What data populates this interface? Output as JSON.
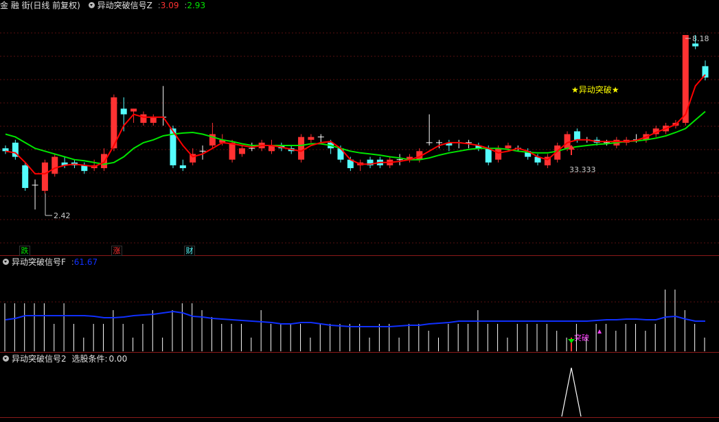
{
  "main_panel": {
    "stock_name": "金 融 街",
    "period_info": "(日线 前复权)",
    "indicator_name": "异动突破信号Z",
    "value_red": "3.09",
    "value_green": "2.93",
    "high_label": "8.18",
    "low_label": "2.42",
    "signal_text": "★异动突破★",
    "signal_value": "33.333",
    "badges": [
      "跌",
      "涨",
      "财"
    ],
    "colors": {
      "up": "#ff3232",
      "down": "#54fcfc",
      "ma_fast": "#ff0000",
      "ma_slow": "#00e600",
      "signal": "#ffff00"
    }
  },
  "panel_f": {
    "indicator_name": "异动突破信号F",
    "value": "61.67",
    "marker_text": "突破",
    "colors": {
      "line": "#1030ff",
      "bars": "#ffffff",
      "marker": "#ff40ff"
    }
  },
  "panel_2": {
    "indicator_name": "异动突破信号2",
    "condition_label": "选股条件:",
    "condition_value": "0.00"
  },
  "chart_data": {
    "type": "candlestick",
    "candles": [
      {
        "o": 3.5,
        "c": 3.45,
        "h": 3.55,
        "l": 3.4
      },
      {
        "o": 3.6,
        "c": 3.35,
        "h": 3.65,
        "l": 3.3
      },
      {
        "o": 3.2,
        "c": 2.8,
        "h": 3.25,
        "l": 2.75
      },
      {
        "o": 2.85,
        "c": 2.85,
        "h": 2.95,
        "l": 2.42
      },
      {
        "o": 2.75,
        "c": 3.25,
        "h": 3.3,
        "l": 2.7
      },
      {
        "o": 3.05,
        "c": 3.35,
        "h": 3.4,
        "l": 3.0
      },
      {
        "o": 3.25,
        "c": 3.2,
        "h": 3.35,
        "l": 3.15
      },
      {
        "o": 3.25,
        "c": 3.2,
        "h": 3.3,
        "l": 3.15
      },
      {
        "o": 3.2,
        "c": 3.1,
        "h": 3.25,
        "l": 3.05
      },
      {
        "o": 3.15,
        "c": 3.2,
        "h": 3.3,
        "l": 3.1
      },
      {
        "o": 3.15,
        "c": 3.4,
        "h": 3.5,
        "l": 3.1
      },
      {
        "o": 3.5,
        "c": 4.4,
        "h": 4.45,
        "l": 3.45
      },
      {
        "o": 4.2,
        "c": 4.1,
        "h": 4.4,
        "l": 3.8
      },
      {
        "o": 4.15,
        "c": 4.2,
        "h": 4.2,
        "l": 3.95
      },
      {
        "o": 3.95,
        "c": 4.1,
        "h": 4.15,
        "l": 3.9
      },
      {
        "o": 3.95,
        "c": 4.05,
        "h": 4.1,
        "l": 3.9
      },
      {
        "o": 4.05,
        "c": 4.05,
        "h": 4.6,
        "l": 3.9
      },
      {
        "o": 3.85,
        "c": 3.2,
        "h": 3.9,
        "l": 3.15
      },
      {
        "o": 3.2,
        "c": 3.15,
        "h": 3.3,
        "l": 3.1
      },
      {
        "o": 3.25,
        "c": 3.4,
        "h": 3.5,
        "l": 3.2
      },
      {
        "o": 3.45,
        "c": 3.45,
        "h": 3.55,
        "l": 3.3
      },
      {
        "o": 3.55,
        "c": 3.75,
        "h": 3.95,
        "l": 3.5
      },
      {
        "o": 3.6,
        "c": 3.65,
        "h": 3.75,
        "l": 3.55
      },
      {
        "o": 3.3,
        "c": 3.6,
        "h": 3.65,
        "l": 3.25
      },
      {
        "o": 3.4,
        "c": 3.5,
        "h": 3.55,
        "l": 3.35
      },
      {
        "o": 3.5,
        "c": 3.5,
        "h": 3.6,
        "l": 3.45
      },
      {
        "o": 3.5,
        "c": 3.6,
        "h": 3.65,
        "l": 3.45
      },
      {
        "o": 3.45,
        "c": 3.55,
        "h": 3.65,
        "l": 3.4
      },
      {
        "o": 3.55,
        "c": 3.5,
        "h": 3.6,
        "l": 3.45
      },
      {
        "o": 3.5,
        "c": 3.45,
        "h": 3.55,
        "l": 3.4
      },
      {
        "o": 3.3,
        "c": 3.7,
        "h": 3.75,
        "l": 3.25
      },
      {
        "o": 3.65,
        "c": 3.7,
        "h": 3.75,
        "l": 3.6
      },
      {
        "o": 3.7,
        "c": 3.7,
        "h": 3.75,
        "l": 3.6
      },
      {
        "o": 3.6,
        "c": 3.5,
        "h": 3.65,
        "l": 3.4
      },
      {
        "o": 3.5,
        "c": 3.3,
        "h": 3.55,
        "l": 3.25
      },
      {
        "o": 3.3,
        "c": 3.15,
        "h": 3.35,
        "l": 3.1
      },
      {
        "o": 3.2,
        "c": 3.25,
        "h": 3.3,
        "l": 3.1
      },
      {
        "o": 3.3,
        "c": 3.2,
        "h": 3.35,
        "l": 3.15
      },
      {
        "o": 3.3,
        "c": 3.2,
        "h": 3.35,
        "l": 3.15
      },
      {
        "o": 3.2,
        "c": 3.3,
        "h": 3.35,
        "l": 3.15
      },
      {
        "o": 3.3,
        "c": 3.3,
        "h": 3.4,
        "l": 3.2
      },
      {
        "o": 3.3,
        "c": 3.35,
        "h": 3.4,
        "l": 3.25
      },
      {
        "o": 3.3,
        "c": 3.45,
        "h": 3.5,
        "l": 3.25
      },
      {
        "o": 3.6,
        "c": 3.6,
        "h": 4.1,
        "l": 3.55
      },
      {
        "o": 3.6,
        "c": 3.6,
        "h": 3.65,
        "l": 3.5
      },
      {
        "o": 3.6,
        "c": 3.55,
        "h": 3.65,
        "l": 3.45
      },
      {
        "o": 3.6,
        "c": 3.6,
        "h": 3.65,
        "l": 3.5
      },
      {
        "o": 3.6,
        "c": 3.6,
        "h": 3.65,
        "l": 3.5
      },
      {
        "o": 3.55,
        "c": 3.5,
        "h": 3.6,
        "l": 3.45
      },
      {
        "o": 3.5,
        "c": 3.25,
        "h": 3.55,
        "l": 3.2
      },
      {
        "o": 3.3,
        "c": 3.5,
        "h": 3.55,
        "l": 3.25
      },
      {
        "o": 3.5,
        "c": 3.55,
        "h": 3.6,
        "l": 3.45
      },
      {
        "o": 3.5,
        "c": 3.5,
        "h": 3.55,
        "l": 3.45
      },
      {
        "o": 3.45,
        "c": 3.35,
        "h": 3.5,
        "l": 3.3
      },
      {
        "o": 3.35,
        "c": 3.25,
        "h": 3.4,
        "l": 3.2
      },
      {
        "o": 3.2,
        "c": 3.35,
        "h": 3.4,
        "l": 3.15
      },
      {
        "o": 3.3,
        "c": 3.55,
        "h": 3.6,
        "l": 3.25
      },
      {
        "o": 3.5,
        "c": 3.75,
        "h": 3.8,
        "l": 3.45
      },
      {
        "o": 3.8,
        "c": 3.65,
        "h": 3.85,
        "l": 3.6
      },
      {
        "o": 3.65,
        "c": 3.65,
        "h": 3.7,
        "l": 3.6
      },
      {
        "o": 3.65,
        "c": 3.6,
        "h": 3.7,
        "l": 3.55
      },
      {
        "o": 3.6,
        "c": 3.6,
        "h": 3.65,
        "l": 3.55
      },
      {
        "o": 3.55,
        "c": 3.65,
        "h": 3.7,
        "l": 3.5
      },
      {
        "o": 3.6,
        "c": 3.65,
        "h": 3.7,
        "l": 3.55
      },
      {
        "o": 3.65,
        "c": 3.65,
        "h": 3.75,
        "l": 3.6
      },
      {
        "o": 3.65,
        "c": 3.75,
        "h": 3.8,
        "l": 3.6
      },
      {
        "o": 3.75,
        "c": 3.85,
        "h": 3.9,
        "l": 3.7
      },
      {
        "o": 3.8,
        "c": 3.9,
        "h": 3.95,
        "l": 3.75
      },
      {
        "o": 3.9,
        "c": 3.95,
        "h": 4.0,
        "l": 3.85
      },
      {
        "o": 3.95,
        "c": 5.5,
        "h": 5.5,
        "l": 3.9
      },
      {
        "o": 5.35,
        "c": 5.3,
        "h": 5.5,
        "l": 5.25
      },
      {
        "o": 4.95,
        "c": 4.75,
        "h": 5.05,
        "l": 4.7
      }
    ],
    "ma_fast": [
      3.45,
      3.42,
      3.25,
      3.05,
      3.05,
      3.15,
      3.2,
      3.22,
      3.2,
      3.18,
      3.25,
      3.55,
      3.9,
      4.1,
      4.05,
      4.05,
      4.05,
      3.8,
      3.55,
      3.35,
      3.4,
      3.5,
      3.6,
      3.58,
      3.55,
      3.52,
      3.55,
      3.55,
      3.52,
      3.48,
      3.45,
      3.55,
      3.6,
      3.62,
      3.5,
      3.3,
      3.22,
      3.22,
      3.25,
      3.25,
      3.27,
      3.3,
      3.35,
      3.45,
      3.55,
      3.6,
      3.6,
      3.58,
      3.55,
      3.5,
      3.42,
      3.45,
      3.5,
      3.45,
      3.35,
      3.3,
      3.45,
      3.6,
      3.65,
      3.65,
      3.62,
      3.62,
      3.62,
      3.62,
      3.64,
      3.7,
      3.78,
      3.85,
      3.92,
      4.1,
      4.6,
      4.8
    ],
    "ma_slow": [
      3.75,
      3.7,
      3.6,
      3.5,
      3.45,
      3.4,
      3.35,
      3.3,
      3.28,
      3.25,
      3.22,
      3.25,
      3.35,
      3.5,
      3.6,
      3.65,
      3.72,
      3.75,
      3.77,
      3.78,
      3.75,
      3.7,
      3.65,
      3.62,
      3.58,
      3.55,
      3.55,
      3.55,
      3.55,
      3.55,
      3.55,
      3.58,
      3.58,
      3.55,
      3.5,
      3.45,
      3.42,
      3.4,
      3.38,
      3.35,
      3.33,
      3.3,
      3.3,
      3.33,
      3.38,
      3.42,
      3.45,
      3.48,
      3.5,
      3.5,
      3.5,
      3.48,
      3.45,
      3.43,
      3.42,
      3.42,
      3.45,
      3.5,
      3.53,
      3.55,
      3.57,
      3.58,
      3.6,
      3.62,
      3.63,
      3.65,
      3.68,
      3.72,
      3.78,
      3.85,
      4.0,
      4.15
    ],
    "ylim": [
      2.0,
      5.9
    ]
  }
}
